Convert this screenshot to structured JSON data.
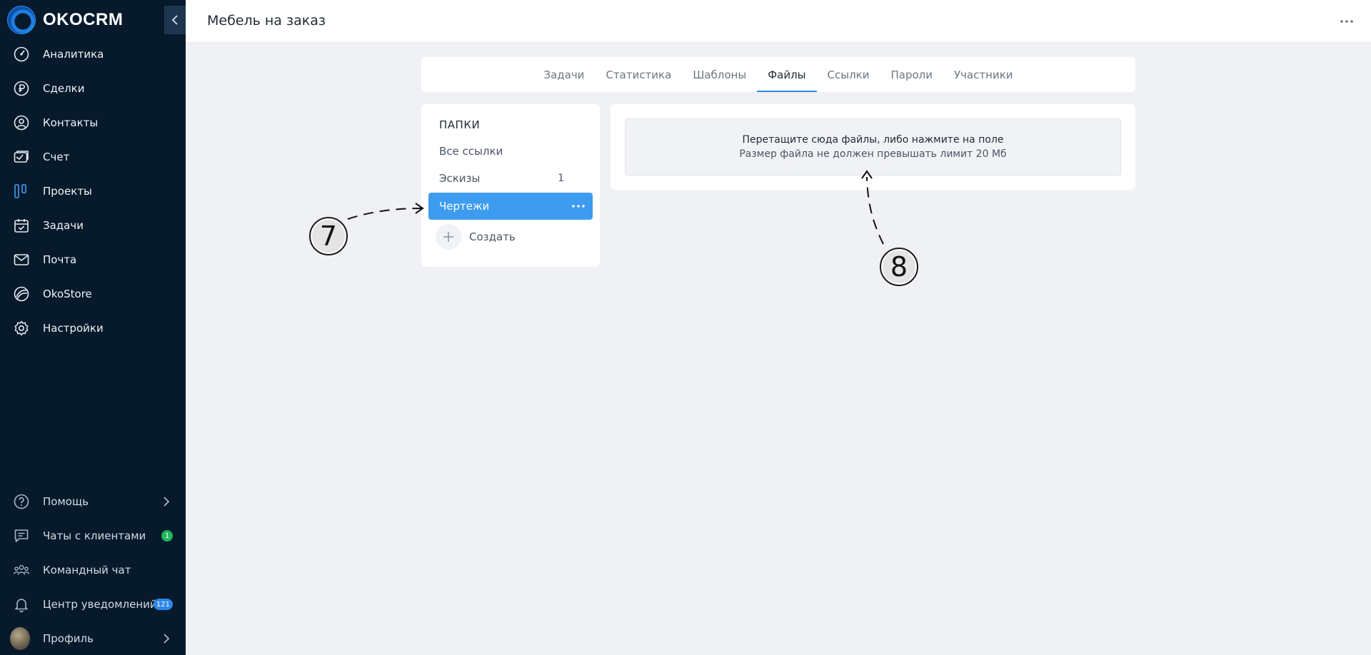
{
  "app": {
    "name": "OKOCRM"
  },
  "sidebar": {
    "items": [
      {
        "label": "Аналитика",
        "icon": "gauge-icon"
      },
      {
        "label": "Сделки",
        "icon": "ruble-icon"
      },
      {
        "label": "Контакты",
        "icon": "user-circle-icon"
      },
      {
        "label": "Счет",
        "icon": "invoice-icon"
      },
      {
        "label": "Проекты",
        "icon": "kanban-icon",
        "accent": "#3d8fe0"
      },
      {
        "label": "Задачи",
        "icon": "calendar-check-icon"
      },
      {
        "label": "Почта",
        "icon": "mail-icon"
      },
      {
        "label": "OkoStore",
        "icon": "store-icon"
      },
      {
        "label": "Настройки",
        "icon": "gear-icon"
      }
    ],
    "bottom": [
      {
        "label": "Помощь",
        "icon": "help-icon"
      },
      {
        "label": "Чаты с клиентами",
        "icon": "chat-icon",
        "badge": "1"
      },
      {
        "label": "Командный чат",
        "icon": "team-icon"
      },
      {
        "label": "Центр уведомлений",
        "icon": "bell-icon",
        "badge": "121"
      },
      {
        "label": "Профиль",
        "icon": "avatar"
      }
    ]
  },
  "header": {
    "title": "Мебель на заказ"
  },
  "tabs": [
    {
      "label": "Задачи"
    },
    {
      "label": "Статистика"
    },
    {
      "label": "Шаблоны"
    },
    {
      "label": "Файлы",
      "active": true
    },
    {
      "label": "Ссылки"
    },
    {
      "label": "Пароли"
    },
    {
      "label": "Участники"
    }
  ],
  "folders": {
    "title": "ПАПКИ",
    "items": [
      {
        "label": "Все ссылки",
        "count": ""
      },
      {
        "label": "Эскизы",
        "count": "1"
      },
      {
        "label": "Чертежи",
        "count": "",
        "active": true
      }
    ],
    "create_label": "Создать"
  },
  "upload": {
    "main_text": "Перетащите сюда файлы, либо нажмите на поле",
    "sub_text": "Размер файла не должен превышать лимит 20 Мб"
  },
  "annotations": [
    {
      "number": "7"
    },
    {
      "number": "8"
    }
  ],
  "colors": {
    "sidebar_bg": "#071a2c",
    "accent": "#3d9cf0",
    "badge_green": "#22b55a",
    "badge_blue": "#2d87e8"
  }
}
